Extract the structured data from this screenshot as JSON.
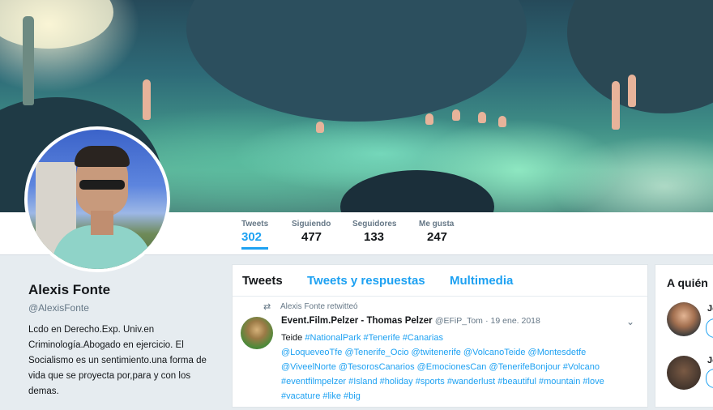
{
  "stats": [
    {
      "label": "Tweets",
      "value": "302"
    },
    {
      "label": "Siguiendo",
      "value": "477"
    },
    {
      "label": "Seguidores",
      "value": "133"
    },
    {
      "label": "Me gusta",
      "value": "247"
    }
  ],
  "profile": {
    "name": "Alexis Fonte",
    "handle": "@AlexisFonte",
    "bio": "Lcdo en Derecho.Exp. Univ.en Criminología.Abogado en ejercicio. El Socialismo es un sentimiento.una forma de vida que se proyecta por,para y con los demas."
  },
  "timeline": {
    "tabs": [
      "Tweets",
      "Tweets y respuestas",
      "Multimedia"
    ],
    "tweet": {
      "retweet_note": "Alexis Fonte retwitteó",
      "author_name": "Event.Film.Pelzer - Thomas Pelzer",
      "author_handle": "@EFiP_Tom",
      "date": "· 19 ene. 2018",
      "text_start": "Teide",
      "hashtags_1": "#NationalPark #Tenerife #Canarias",
      "mentions_1": "@LoqueveoTfe @Tenerife_Ocio @twitenerife @VolcanoTeide @Montesdetfe",
      "mentions_2": "@ViveelNorte @TesorosCanarios @EmocionesCan @TenerifeBonjour #Volcano",
      "hashtags_2": "#eventfilmpelzer #Island #holiday #sports #wanderlust #beautiful #mountain #love",
      "hashtags_3": "#vacature #like #big"
    }
  },
  "sidebar_right": {
    "title": "A quién",
    "suggestions": [
      {
        "name": "Jo"
      },
      {
        "name": "Jo"
      }
    ]
  },
  "icons": {
    "retweet": "retweet-icon",
    "chevron": "chevron-down-icon"
  },
  "colors": {
    "accent": "#1da1f2",
    "muted": "#657786"
  }
}
